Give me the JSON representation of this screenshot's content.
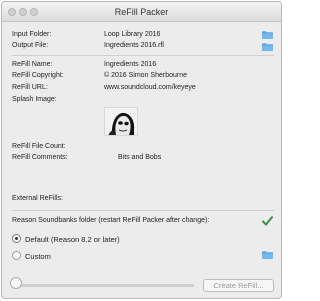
{
  "window": {
    "title": "ReFill Packer"
  },
  "input_folder": {
    "label": "Input Folder:",
    "value": "Loop Library 2016",
    "icon": "folder-icon"
  },
  "output_file": {
    "label": "Output File:",
    "value": "Ingredients 2016.rfl",
    "icon": "folder-icon"
  },
  "refill_name": {
    "label": "ReFill Name:",
    "value": "Ingredients 2016"
  },
  "refill_copyright": {
    "label": "ReFill Copyright:",
    "value": "© 2016 Simon Sherbourne"
  },
  "refill_url": {
    "label": "ReFill URL:",
    "value": "www.soundcloud.com/keyeye"
  },
  "splash_image": {
    "label": "Splash Image:"
  },
  "file_count": {
    "label": "ReFill File Count:",
    "value": ""
  },
  "comments": {
    "label": "ReFill Comments:",
    "value": "Bits and Bobs"
  },
  "external": {
    "label": "External ReFills:"
  },
  "soundbanks": {
    "label": "Reason Soundbanks folder (restart ReFill Packer after change):",
    "check_color": "#3f8e3f"
  },
  "options": {
    "default_label": "Default (Reason 8.2 or later)",
    "custom_label": "Custom",
    "selected": "default"
  },
  "footer": {
    "button_label": "Create ReFill..."
  }
}
